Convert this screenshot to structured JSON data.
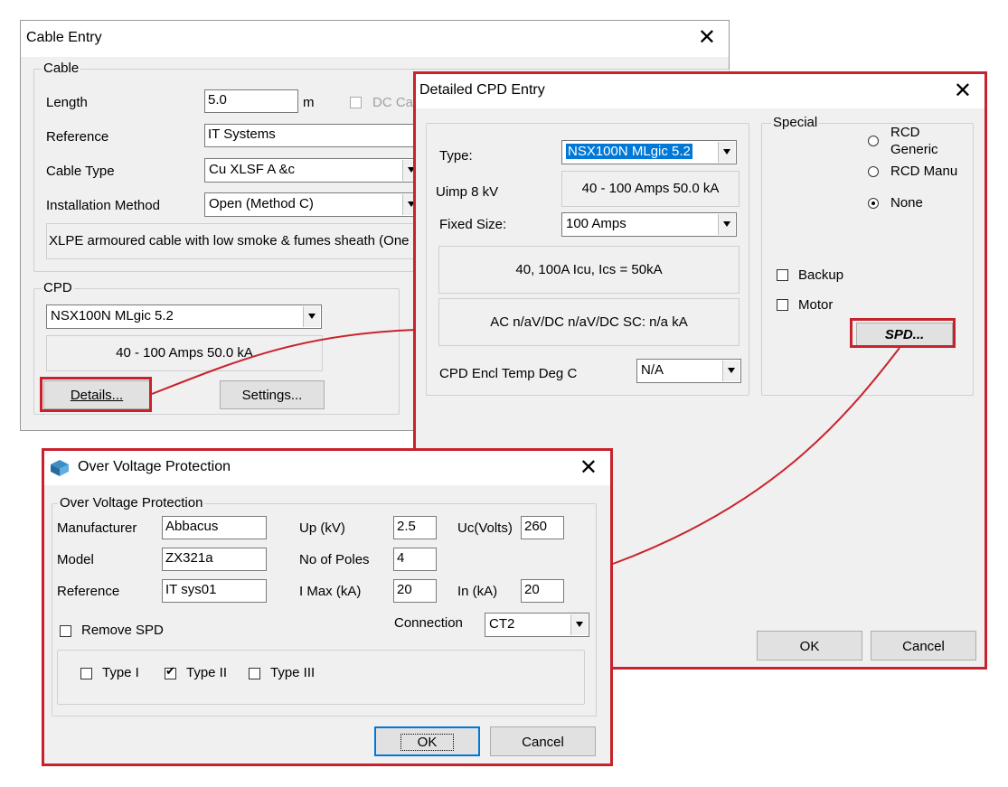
{
  "cable_entry": {
    "title": "Cable Entry",
    "close": "✕",
    "cable_group": "Cable",
    "length_label": "Length",
    "length_value": "5.0",
    "length_unit": "m",
    "dc_cable_label": "DC Ca",
    "reference_label": "Reference",
    "reference_value": "IT Systems",
    "cable_type_label": "Cable Type",
    "cable_type_value": "Cu XLSF A &c",
    "installation_label": "Installation Method",
    "installation_value": "Open (Method C)",
    "description": "XLPE armoured cable with low smoke & fumes sheath (One",
    "cpd_group": "CPD",
    "cpd_value": "NSX100N MLgic 5.2",
    "cpd_rating": "40 - 100 Amps   50.0 kA",
    "details_button": "Details...",
    "settings_button": "Settings..."
  },
  "detailed_cpd": {
    "title": "Detailed CPD Entry",
    "close": "✕",
    "type_label": "Type:",
    "type_value": "NSX100N MLgic 5.2",
    "uimp_label": "Uimp 8 kV",
    "rating_text": "40 - 100 Amps   50.0 kA",
    "fixed_size_label": "Fixed Size:",
    "fixed_size_value": "100 Amps",
    "icu_text": "40, 100A Icu, Ics = 50kA",
    "ac_text": "AC n/aV/DC n/aV/DC SC: n/a kA",
    "encl_temp_label": "CPD Encl Temp  Deg C",
    "encl_temp_value": "N/A",
    "special_group": "Special",
    "rcd_generic": "RCD Generic",
    "rcd_manu": "RCD Manu",
    "none": "None",
    "backup": "Backup",
    "motor": "Motor",
    "spd_button": "SPD...",
    "ok": "OK",
    "cancel": "Cancel"
  },
  "ovp": {
    "title": "Over Voltage Protection",
    "close": "✕",
    "group": "Over Voltage Protection",
    "manufacturer_label": "Manufacturer",
    "manufacturer_value": "Abbacus",
    "model_label": "Model",
    "model_value": "ZX321a",
    "reference_label": "Reference",
    "reference_value": "IT sys01",
    "up_label": "Up (kV)",
    "up_value": "2.5",
    "poles_label": "No of  Poles",
    "poles_value": "4",
    "imax_label": "I Max (kA)",
    "imax_value": "20",
    "uc_label": "Uc(Volts)",
    "uc_value": "260",
    "in_label": "In (kA)",
    "in_value": "20",
    "remove_spd": "Remove SPD",
    "connection_label": "Connection",
    "connection_value": "CT2",
    "type1": "Type I",
    "type2": "Type II",
    "type3": "Type III",
    "ok": "OK",
    "cancel": "Cancel"
  },
  "colors": {
    "highlight": "#c8232c",
    "selection": "#0078d7"
  }
}
